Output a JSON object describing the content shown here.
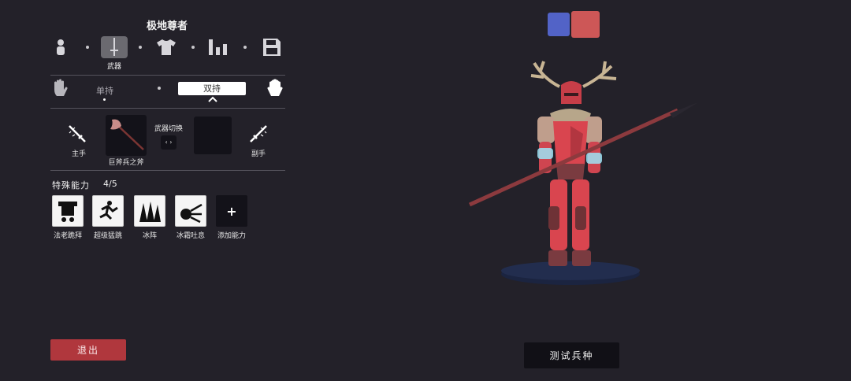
{
  "unit_title": "极地尊者",
  "tabs": {
    "weapon_label": "武器"
  },
  "grip": {
    "single": "单持",
    "dual": "双持"
  },
  "weapons": {
    "main_hand_label": "主手",
    "main_weapon_name": "巨斧兵之斧",
    "switch_label": "武器切换",
    "switch_icon": "‹ ›",
    "off_hand_label": "副手"
  },
  "abilities": {
    "title": "特殊能力",
    "count": "4/5",
    "items": [
      {
        "label": "法老跪拜",
        "icon": "pharaoh-kneel-icon"
      },
      {
        "label": "超级猛跳",
        "icon": "super-jump-icon"
      },
      {
        "label": "冰阵",
        "icon": "ice-formation-icon"
      },
      {
        "label": "冰霜吐息",
        "icon": "frost-breath-icon"
      },
      {
        "label": "添加能力",
        "icon": "plus-icon",
        "symbol": "+"
      }
    ]
  },
  "buttons": {
    "exit": "退出",
    "test": "测试兵种"
  },
  "team_colors": {
    "blue": "#5263c7",
    "red": "#cd5757"
  },
  "colors": {
    "accent_red": "#b0373d",
    "unit_body": "#d9454f"
  }
}
